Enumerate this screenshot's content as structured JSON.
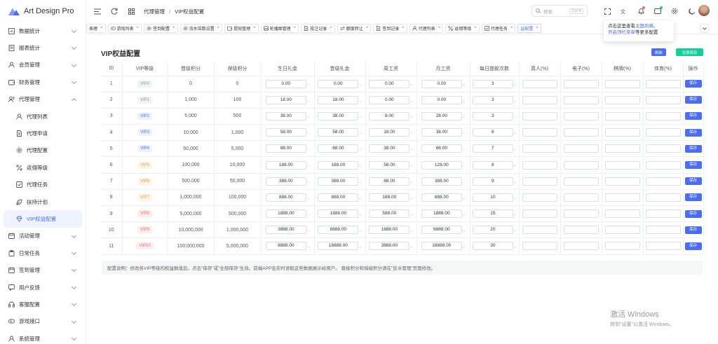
{
  "app": {
    "title": "Art Design Pro"
  },
  "sidebar": {
    "items": [
      {
        "label": "数据统计",
        "icon": "dashboard-icon"
      },
      {
        "label": "报表统计",
        "icon": "report-icon"
      },
      {
        "label": "会员管理",
        "icon": "user-icon"
      },
      {
        "label": "财务管理",
        "icon": "wallet-icon"
      },
      {
        "label": "代理管理",
        "icon": "agent-icon",
        "expanded": true
      },
      {
        "label": "代理列表",
        "icon": "user-icon",
        "sub": true
      },
      {
        "label": "代理申请",
        "icon": "document-icon",
        "sub": true
      },
      {
        "label": "代理配置",
        "icon": "gear-icon",
        "sub": true
      },
      {
        "label": "返佣等级",
        "icon": "percent-icon",
        "sub": true
      },
      {
        "label": "代理任务",
        "icon": "task-icon",
        "sub": true
      },
      {
        "label": "扶持计划",
        "icon": "leaf-icon",
        "sub": true
      },
      {
        "label": "VIP权益配置",
        "icon": "diamond-icon",
        "sub": true,
        "active": true
      },
      {
        "label": "活动管理",
        "icon": "calendar-icon"
      },
      {
        "label": "日常任务",
        "icon": "clipboard-icon"
      },
      {
        "label": "签到管理",
        "icon": "calendar-icon"
      },
      {
        "label": "用户反馈",
        "icon": "message-icon"
      },
      {
        "label": "客服配置",
        "icon": "headset-icon"
      },
      {
        "label": "游戏接口",
        "icon": "gamepad-icon"
      },
      {
        "label": "系统管理",
        "icon": "user-icon"
      }
    ]
  },
  "header": {
    "breadcrumb": [
      "代理管理",
      "VIP权益配置"
    ],
    "search": {
      "placeholder": "搜索",
      "shortcut": "Ctrl K"
    }
  },
  "tabs": [
    {
      "label": "表理",
      "icon": ""
    },
    {
      "label": "游戏列表",
      "icon": "gamepad-icon"
    },
    {
      "label": "签到配置",
      "icon": "gear-icon"
    },
    {
      "label": "流水倍数设置",
      "icon": "gear-icon"
    },
    {
      "label": "提现管理",
      "icon": "wallet-icon"
    },
    {
      "label": "轮播图管理",
      "icon": "image-icon"
    },
    {
      "label": "投注记录",
      "icon": "document-icon"
    },
    {
      "label": "额度转让",
      "icon": "transfer-icon"
    },
    {
      "label": "签到记录",
      "icon": "document-icon"
    },
    {
      "label": "代理列表",
      "icon": "user-icon"
    },
    {
      "label": "返佣等级",
      "icon": "percent-icon"
    },
    {
      "label": "代理任务",
      "icon": "task-icon"
    },
    {
      "label": "益配置",
      "icon": "",
      "active": true
    }
  ],
  "tooltip": {
    "line1_a": "点击这里查看",
    "line1_b": "主题风格",
    "line1_c": "、",
    "line2_a": "开启顶栏菜单",
    "line2_b": "等更多配置"
  },
  "page": {
    "title": "VIP权益配置",
    "refresh_label": "刷新",
    "save_all_label": "全部保存",
    "columns": [
      "ID",
      "VIP等级",
      "晋级积分",
      "保级积分",
      "生日礼金",
      "晋级礼金",
      "周工资",
      "月工资",
      "每日提款次数",
      "真人(%)",
      "电子(%)",
      "棋牌(%)",
      "体育(%)",
      "操作"
    ],
    "save_label": "保存",
    "rows": [
      {
        "id": "1",
        "vip": "VIP0",
        "up": "0",
        "keep": "0",
        "birthday": "0.00",
        "promo": "0.00",
        "weekly": "0.00",
        "monthly": "0.00",
        "withdraw": "3"
      },
      {
        "id": "2",
        "vip": "VIP1",
        "up": "1,000",
        "keep": "100",
        "birthday": "18.00",
        "promo": "18.00",
        "weekly": "0.00",
        "monthly": "0.00",
        "withdraw": "3"
      },
      {
        "id": "3",
        "vip": "VIP2",
        "up": "5,000",
        "keep": "500",
        "birthday": "38.00",
        "promo": "38.00",
        "weekly": "8.00",
        "monthly": "28.00",
        "withdraw": "3"
      },
      {
        "id": "4",
        "vip": "VIP3",
        "up": "10,000",
        "keep": "1,000",
        "birthday": "58.00",
        "promo": "58.00",
        "weekly": "18.00",
        "monthly": "38.00",
        "withdraw": "6"
      },
      {
        "id": "5",
        "vip": "VIP4",
        "up": "50,000",
        "keep": "5,000",
        "birthday": "88.00",
        "promo": "88.00",
        "weekly": "38.00",
        "monthly": "68.00",
        "withdraw": "7"
      },
      {
        "id": "6",
        "vip": "VIP5",
        "up": "100,000",
        "keep": "10,000",
        "birthday": "188.00",
        "promo": "188.00",
        "weekly": "58.00",
        "monthly": "128.00",
        "withdraw": "8"
      },
      {
        "id": "7",
        "vip": "VIP6",
        "up": "500,000",
        "keep": "50,000",
        "birthday": "388.00",
        "promo": "388.00",
        "weekly": "88.00",
        "monthly": "388.00",
        "withdraw": "9"
      },
      {
        "id": "8",
        "vip": "VIP7",
        "up": "1,000,000",
        "keep": "100,000",
        "birthday": "888.00",
        "promo": "888.00",
        "weekly": "188.00",
        "monthly": "888.00",
        "withdraw": "10"
      },
      {
        "id": "9",
        "vip": "VIP8",
        "up": "5,000,000",
        "keep": "500,000",
        "birthday": "1888.00",
        "promo": "1888.00",
        "weekly": "588.00",
        "monthly": "1888.00",
        "withdraw": "15"
      },
      {
        "id": "10",
        "vip": "VIP9",
        "up": "10,000,000",
        "keep": "1,000,000",
        "birthday": "3888.00",
        "promo": "8888.00",
        "weekly": "1888.00",
        "monthly": "6888.00",
        "withdraw": "20"
      },
      {
        "id": "11",
        "vip": "VIP10",
        "up": "100,000,000",
        "keep": "5,000,000",
        "birthday": "8888.00",
        "promo": "18888.00",
        "weekly": "3888.00",
        "monthly": "18888.00",
        "withdraw": "30"
      }
    ],
    "note": "配置说明：修改各VIP等级的权益数值后，点击\"保存\"或\"全部保存\"生效。前端APP会实时读取这些数据展示给用户。 晋级积分和保级积分请在\"反水管理\"页面修改。"
  },
  "watermark": {
    "line1": "激活 Windows",
    "line2": "转到\"设置\"以激活 Windows。"
  },
  "colors": {
    "accent": "#4a6cf7",
    "success": "#13ce9c",
    "vip_grey": "#f2f3f5",
    "vip_blue": "#ecf2ff",
    "vip_orange": "#fff4e5",
    "vip_red": "#ffecec"
  }
}
